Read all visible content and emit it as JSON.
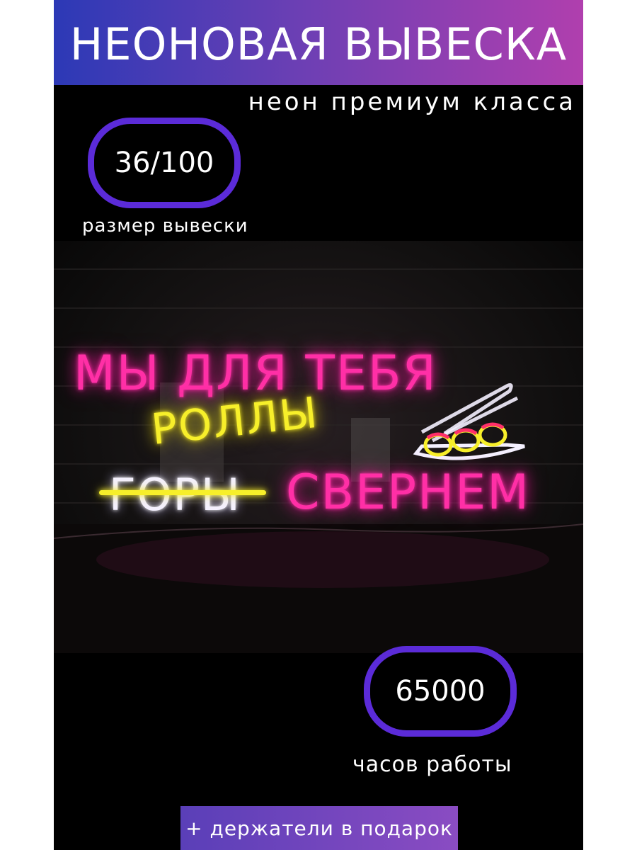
{
  "header": {
    "title": "НЕОНОВАЯ ВЫВЕСКА",
    "subtitle": "неон премиум класса"
  },
  "size_badge": {
    "value": "36/100",
    "caption": "размер вывески"
  },
  "sign": {
    "line1": "МЫ ДЛЯ ТЕБЯ",
    "line2": "РОЛЛЫ",
    "line3_struck": "ГОРЫ",
    "line3": "СВЕРНЕМ",
    "colors": {
      "pink": "#ff2fa6",
      "yellow": "#f7ef2a",
      "white": "#f4f0ff"
    },
    "icon": "sushi-rolls-with-chopsticks-icon"
  },
  "hours_badge": {
    "value": "65000",
    "caption": "часов работы"
  },
  "promo": {
    "text": "+ держатели в подарок"
  },
  "colors": {
    "accent_border": "#5b2bd8",
    "header_gradient_start": "#2c39b6",
    "header_gradient_end": "#b03fae",
    "background": "#000000"
  }
}
